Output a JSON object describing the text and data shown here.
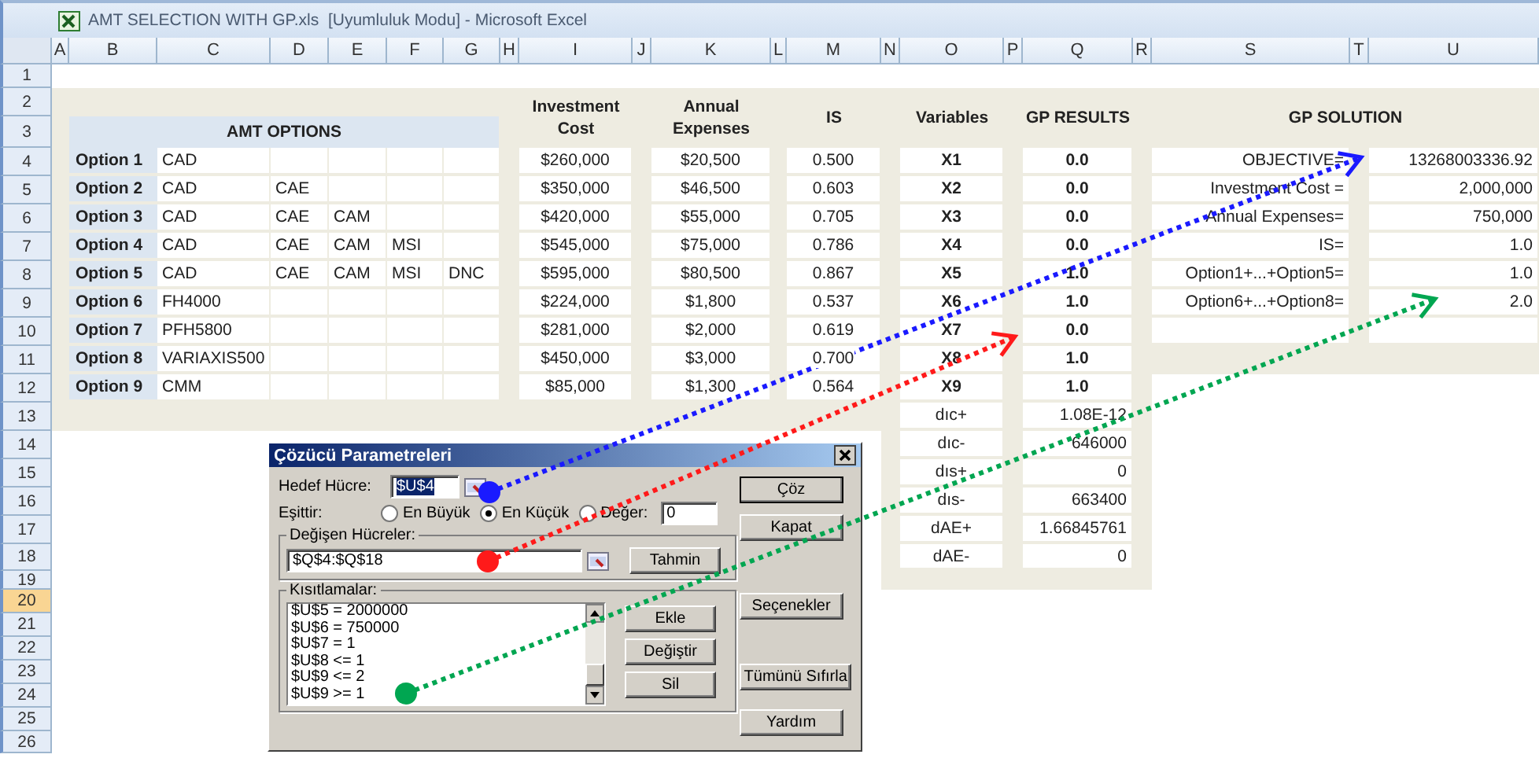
{
  "window": {
    "title": "AMT SELECTION WITH GP.xls  [Uyumluluk Modu] - Microsoft Excel"
  },
  "column_headers": [
    "A",
    "B",
    "C",
    "D",
    "E",
    "F",
    "G",
    "H",
    "I",
    "J",
    "K",
    "L",
    "M",
    "N",
    "O",
    "P",
    "Q",
    "R",
    "S",
    "T",
    "U"
  ],
  "row_headers": [
    {
      "label": "1",
      "selected": false
    },
    {
      "label": "2",
      "selected": false
    },
    {
      "label": "3",
      "selected": false
    },
    {
      "label": "4",
      "selected": false
    },
    {
      "label": "5",
      "selected": false
    },
    {
      "label": "6",
      "selected": false
    },
    {
      "label": "7",
      "selected": false
    },
    {
      "label": "8",
      "selected": false
    },
    {
      "label": "9",
      "selected": false
    },
    {
      "label": "10",
      "selected": false
    },
    {
      "label": "11",
      "selected": false
    },
    {
      "label": "12",
      "selected": false
    },
    {
      "label": "13",
      "selected": false
    },
    {
      "label": "14",
      "selected": false
    },
    {
      "label": "15",
      "selected": false
    },
    {
      "label": "16",
      "selected": false
    },
    {
      "label": "17",
      "selected": false
    },
    {
      "label": "18",
      "selected": false
    },
    {
      "label": "19",
      "selected": false
    },
    {
      "label": "20",
      "selected": true
    },
    {
      "label": "21",
      "selected": false
    },
    {
      "label": "22",
      "selected": false
    },
    {
      "label": "23",
      "selected": false
    },
    {
      "label": "24",
      "selected": false
    },
    {
      "label": "25",
      "selected": false
    },
    {
      "label": "26",
      "selected": false
    }
  ],
  "amt_options": {
    "title": "AMT OPTIONS",
    "rows": [
      {
        "label": "Option 1",
        "items": [
          "CAD"
        ]
      },
      {
        "label": "Option 2",
        "items": [
          "CAD",
          "CAE"
        ]
      },
      {
        "label": "Option 3",
        "items": [
          "CAD",
          "CAE",
          "CAM"
        ]
      },
      {
        "label": "Option 4",
        "items": [
          "CAD",
          "CAE",
          "CAM",
          "MSI"
        ]
      },
      {
        "label": "Option 5",
        "items": [
          "CAD",
          "CAE",
          "CAM",
          "MSI",
          "DNC"
        ]
      },
      {
        "label": "Option 6",
        "items": [
          "FH4000"
        ]
      },
      {
        "label": "Option 7",
        "items": [
          "PFH5800"
        ]
      },
      {
        "label": "Option 8",
        "items": [
          "VARIAXIS500"
        ]
      },
      {
        "label": "Option 9",
        "items": [
          "CMM"
        ]
      }
    ]
  },
  "investment_cost": {
    "header": "Investment Cost",
    "values": [
      "$260,000",
      "$350,000",
      "$420,000",
      "$545,000",
      "$595,000",
      "$224,000",
      "$281,000",
      "$450,000",
      "$85,000"
    ]
  },
  "annual_expenses": {
    "header": "Annual Expenses",
    "values": [
      "$20,500",
      "$46,500",
      "$55,000",
      "$75,000",
      "$80,500",
      "$1,800",
      "$2,000",
      "$3,000",
      "$1,300"
    ]
  },
  "is": {
    "header": "IS",
    "values": [
      "0.500",
      "0.603",
      "0.705",
      "0.786",
      "0.867",
      "0.537",
      "0.619",
      "0.700",
      "0.564"
    ]
  },
  "gp_results": {
    "variables_header": "Variables",
    "results_header": "GP RESULTS",
    "rows": [
      {
        "kind": "decision",
        "variable": "X1",
        "result": "0.0"
      },
      {
        "kind": "decision",
        "variable": "X2",
        "result": "0.0"
      },
      {
        "kind": "decision",
        "variable": "X3",
        "result": "0.0"
      },
      {
        "kind": "decision",
        "variable": "X4",
        "result": "0.0"
      },
      {
        "kind": "decision",
        "variable": "X5",
        "result": "1.0"
      },
      {
        "kind": "decision",
        "variable": "X6",
        "result": "1.0"
      },
      {
        "kind": "decision",
        "variable": "X7",
        "result": "0.0"
      },
      {
        "kind": "decision",
        "variable": "X8",
        "result": "1.0"
      },
      {
        "kind": "decision",
        "variable": "X9",
        "result": "1.0"
      },
      {
        "kind": "deviation",
        "variable": "dıc+",
        "result": "1.08E-12"
      },
      {
        "kind": "deviation",
        "variable": "dıc-",
        "result": "646000"
      },
      {
        "kind": "deviation",
        "variable": "dıs+",
        "result": "0"
      },
      {
        "kind": "deviation",
        "variable": "dıs-",
        "result": "663400"
      },
      {
        "kind": "deviation",
        "variable": "dAE+",
        "result": "1.66845761"
      },
      {
        "kind": "deviation",
        "variable": "dAE-",
        "result": "0"
      }
    ]
  },
  "gp_solution": {
    "header": "GP SOLUTION",
    "rows": [
      {
        "label": "OBJECTIVE=",
        "value": "13268003336.92"
      },
      {
        "label": "Investment Cost =",
        "value": "2,000,000"
      },
      {
        "label": "Annual Expenses=",
        "value": "750,000"
      },
      {
        "label": "IS=",
        "value": "1.0"
      },
      {
        "label": "Option1+...+Option5=",
        "value": "1.0"
      },
      {
        "label": "Option6+...+Option8=",
        "value": "2.0"
      }
    ]
  },
  "solver_dialog": {
    "title": "Çözücü Parametreleri",
    "target_cell": {
      "label": "Hedef Hücre:",
      "value": "$U$4",
      "value_selected": true
    },
    "equal_to": {
      "label": "Eşittir:",
      "options": [
        {
          "label": "En Büyük",
          "selected": false
        },
        {
          "label": "En Küçük",
          "selected": true
        },
        {
          "label": "Değer:",
          "selected": false
        }
      ],
      "value": "0"
    },
    "changing_cells": {
      "label": "Değişen Hücreler:",
      "value": "$Q$4:$Q$18",
      "button": "Tahmin"
    },
    "constraints": {
      "label": "Kısıtlamalar:",
      "items": [
        "$U$5 = 2000000",
        "$U$6 = 750000",
        "$U$7 = 1",
        "$U$8 <= 1",
        "$U$9 <= 2",
        "$U$9 >= 1"
      ],
      "buttons": [
        "Ekle",
        "Değiştir",
        "Sil"
      ]
    },
    "side_buttons": [
      "Çöz",
      "Kapat",
      "Seçenekler",
      "Tümünü Sıfırla",
      "Yardım"
    ]
  },
  "annotation_arrows": [
    {
      "color": "#1a1aff"
    },
    {
      "color": "#ff1a1a"
    },
    {
      "color": "#00a651"
    }
  ]
}
